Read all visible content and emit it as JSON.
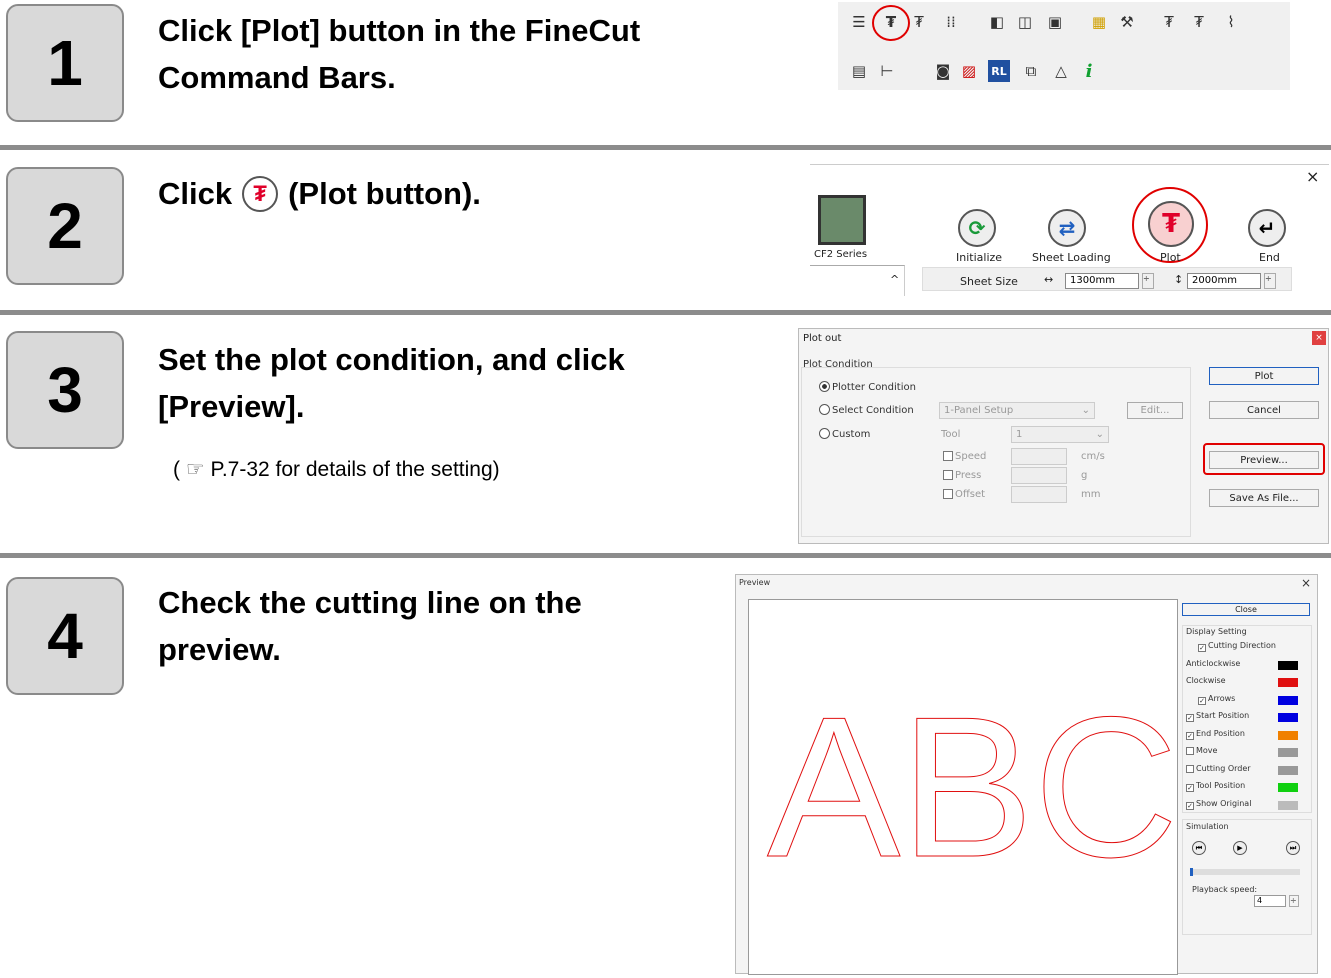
{
  "steps": [
    {
      "number": "1",
      "lines": [
        "Click [Plot] button in the FineCut",
        "Command Bars."
      ]
    },
    {
      "number": "2",
      "click": "Click",
      "rest": "(Plot button)."
    },
    {
      "number": "3",
      "lines": [
        "Set the plot condition, and click",
        "[Preview]."
      ],
      "note_open": "(",
      "note_glyph": "☞",
      "note_text": "P.7-32 for details of the setting)"
    },
    {
      "number": "4",
      "lines": [
        "Check the cutting line on the",
        "preview."
      ]
    }
  ],
  "main_window": {
    "title_label": "CF2 Series",
    "buttons": [
      "Initialize",
      "Sheet Loading",
      "Plot",
      "End"
    ],
    "sheet_size_label": "Sheet Size",
    "width_value": "1300mm",
    "height_value": "2000mm",
    "close_glyph": "×"
  },
  "plot_out": {
    "title": "Plot out",
    "group": "Plot Condition",
    "options": [
      "Plotter Condition",
      "Select Condition",
      "Custom"
    ],
    "select_value": "1-Panel Setup",
    "edit_label": "Edit...",
    "tool_label": "Tool",
    "tool_value": "1",
    "params": [
      {
        "label": "Speed",
        "unit": "cm/s"
      },
      {
        "label": "Press",
        "unit": "g"
      },
      {
        "label": "Offset",
        "unit": "mm"
      }
    ],
    "buttons": [
      "Plot",
      "Cancel",
      "Preview...",
      "Save As File..."
    ]
  },
  "preview": {
    "title": "Preview",
    "close_glyph": "×",
    "close_label": "Close",
    "display_setting": "Display Setting",
    "items": [
      {
        "label": "Cutting Direction",
        "checked": true,
        "color": ""
      },
      {
        "label": "Anticlockwise",
        "checked": null,
        "color": "#000000"
      },
      {
        "label": "Clockwise",
        "checked": null,
        "color": "#e01010"
      },
      {
        "label": "Arrows",
        "checked": true,
        "color": "#0000e0"
      },
      {
        "label": "Start Position",
        "checked": true,
        "color": "#0000e0"
      },
      {
        "label": "End Position",
        "checked": true,
        "color": "#f08000"
      },
      {
        "label": "Move",
        "checked": false,
        "color": "#999999"
      },
      {
        "label": "Cutting Order",
        "checked": false,
        "color": "#999999"
      },
      {
        "label": "Tool Position",
        "checked": true,
        "color": "#10d010"
      },
      {
        "label": "Show Original",
        "checked": true,
        "color": "#bbbbbb"
      }
    ],
    "simulation_label": "Simulation",
    "playback_label": "Playback speed:",
    "playback_value": "4",
    "letters": "ABC"
  }
}
